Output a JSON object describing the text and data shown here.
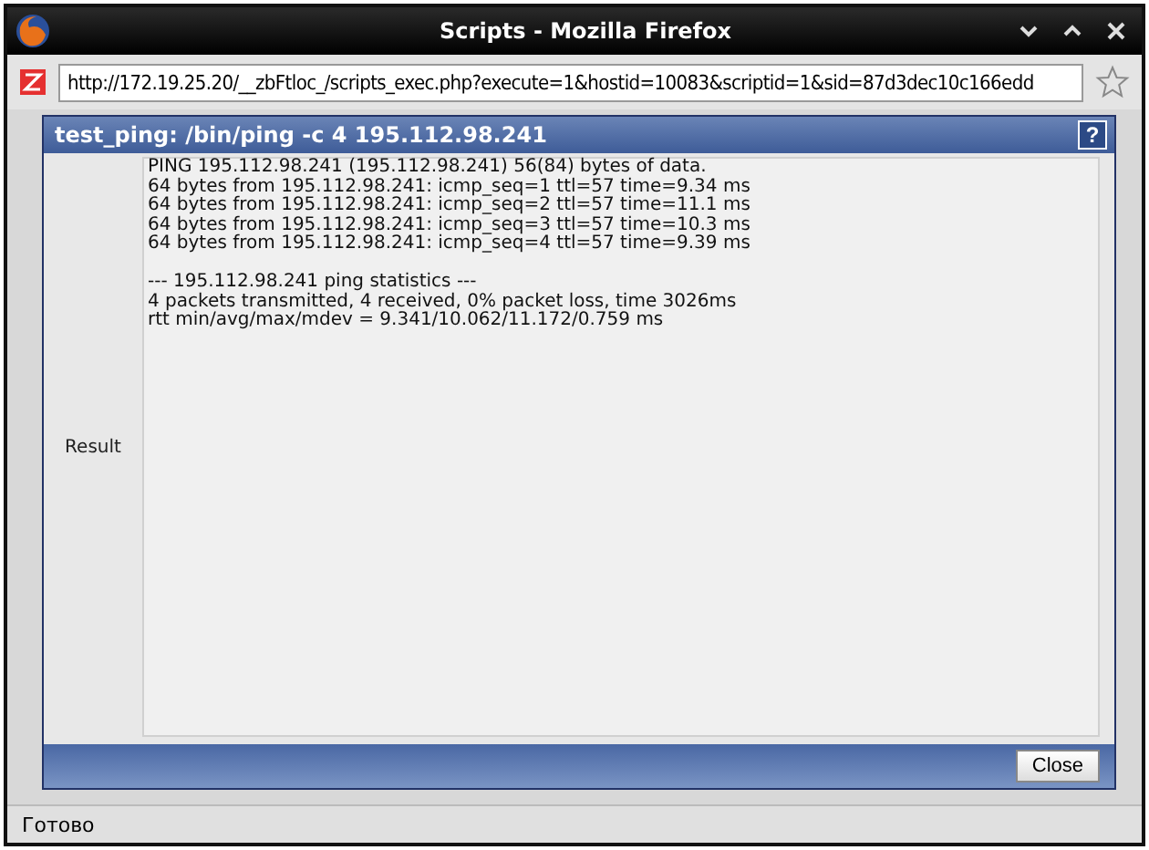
{
  "window": {
    "title": "Scripts - Mozilla Firefox"
  },
  "address_bar": {
    "url": "http://172.19.25.20/__zbFtloc_/scripts_exec.php?execute=1&hostid=10083&scriptid=1&sid=87d3dec10c166edd"
  },
  "panel": {
    "title": "test_ping: /bin/ping -c 4 195.112.98.241",
    "help": "?",
    "label": "Result",
    "output": "PING 195.112.98.241 (195.112.98.241) 56(84) bytes of data.\n64 bytes from 195.112.98.241: icmp_seq=1 ttl=57 time=9.34 ms\n64 bytes from 195.112.98.241: icmp_seq=2 ttl=57 time=11.1 ms\n64 bytes from 195.112.98.241: icmp_seq=3 ttl=57 time=10.3 ms\n64 bytes from 195.112.98.241: icmp_seq=4 ttl=57 time=9.39 ms\n\n--- 195.112.98.241 ping statistics ---\n4 packets transmitted, 4 received, 0% packet loss, time 3026ms\nrtt min/avg/max/mdev = 9.341/10.062/11.172/0.759 ms",
    "buttons": [
      "Close"
    ]
  },
  "status_bar": "Готово"
}
